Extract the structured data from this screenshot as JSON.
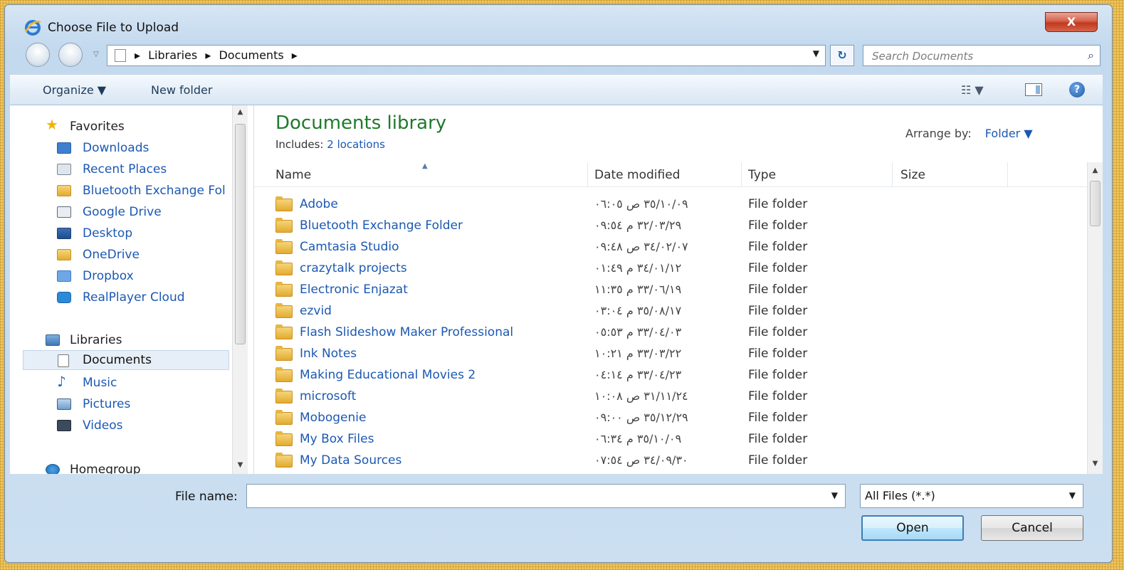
{
  "window": {
    "title": "Choose File to Upload",
    "close_label": "X"
  },
  "address": {
    "crumbs": [
      "Libraries",
      "Documents"
    ]
  },
  "search": {
    "placeholder": "Search Documents"
  },
  "toolbar": {
    "organize": "Organize ▼",
    "new_folder": "New folder"
  },
  "sidebar": {
    "favorites": {
      "label": "Favorites",
      "items": [
        {
          "label": "Downloads",
          "icon": "downloads-icon"
        },
        {
          "label": "Recent Places",
          "icon": "recent-places-icon"
        },
        {
          "label": "Bluetooth Exchange Fol",
          "icon": "folder-icon"
        },
        {
          "label": "Google Drive",
          "icon": "google-drive-icon"
        },
        {
          "label": "Desktop",
          "icon": "desktop-icon"
        },
        {
          "label": "OneDrive",
          "icon": "folder-icon"
        },
        {
          "label": "Dropbox",
          "icon": "dropbox-icon"
        },
        {
          "label": "RealPlayer Cloud",
          "icon": "realplayer-icon"
        }
      ]
    },
    "libraries": {
      "label": "Libraries",
      "items": [
        {
          "label": "Documents",
          "icon": "documents-icon",
          "selected": true
        },
        {
          "label": "Music",
          "icon": "music-icon"
        },
        {
          "label": "Pictures",
          "icon": "pictures-icon"
        },
        {
          "label": "Videos",
          "icon": "videos-icon"
        }
      ]
    },
    "homegroup": {
      "label": "Homegroup"
    }
  },
  "library": {
    "title": "Documents library",
    "includes_label": "Includes:",
    "includes_link": "2 locations",
    "arrange_label": "Arrange by:",
    "arrange_value": "Folder ▼"
  },
  "columns": {
    "name": "Name",
    "date": "Date modified",
    "type": "Type",
    "size": "Size"
  },
  "files": [
    {
      "name": "Adobe",
      "date": "٣٥/١٠/٠٩ ص ٠٦:٠٥",
      "type": "File folder"
    },
    {
      "name": "Bluetooth Exchange Folder",
      "date": "٣٢/٠٣/٢٩ م ٠٩:٥٤",
      "type": "File folder"
    },
    {
      "name": "Camtasia Studio",
      "date": "٣٤/٠٢/٠٧ ص ٠٩:٤٨",
      "type": "File folder"
    },
    {
      "name": "crazytalk projects",
      "date": "٣٤/٠١/١٢ م ٠١:٤٩",
      "type": "File folder"
    },
    {
      "name": "Electronic Enjazat",
      "date": "٣٣/٠٦/١٩ م ١١:٣٥",
      "type": "File folder"
    },
    {
      "name": "ezvid",
      "date": "٣٥/٠٨/١٧ م ٠٣:٠٤",
      "type": "File folder"
    },
    {
      "name": "Flash Slideshow Maker Professional",
      "date": "٣٣/٠٤/٠٣ م ٠٥:٥٣",
      "type": "File folder"
    },
    {
      "name": "Ink Notes",
      "date": "٣٣/٠٣/٢٢ م ١٠:٢١",
      "type": "File folder"
    },
    {
      "name": "Making Educational Movies 2",
      "date": "٣٣/٠٤/٢٣ م ٠٤:١٤",
      "type": "File folder"
    },
    {
      "name": "microsoft",
      "date": "٣١/١١/٢٤ ص ١٠:٠٨",
      "type": "File folder"
    },
    {
      "name": "Mobogenie",
      "date": "٣٥/١٢/٢٩ ص ٠٩:٠٠",
      "type": "File folder"
    },
    {
      "name": "My Box Files",
      "date": "٣٥/١٠/٠٩ م ٠٦:٣٤",
      "type": "File folder"
    },
    {
      "name": "My Data Sources",
      "date": "٣٤/٠٩/٣٠ ص ٠٧:٥٤",
      "type": "File folder"
    }
  ],
  "bottom": {
    "file_name_label": "File name:",
    "file_name_value": "",
    "filter": "All Files (*.*)",
    "open": "Open",
    "cancel": "Cancel"
  }
}
